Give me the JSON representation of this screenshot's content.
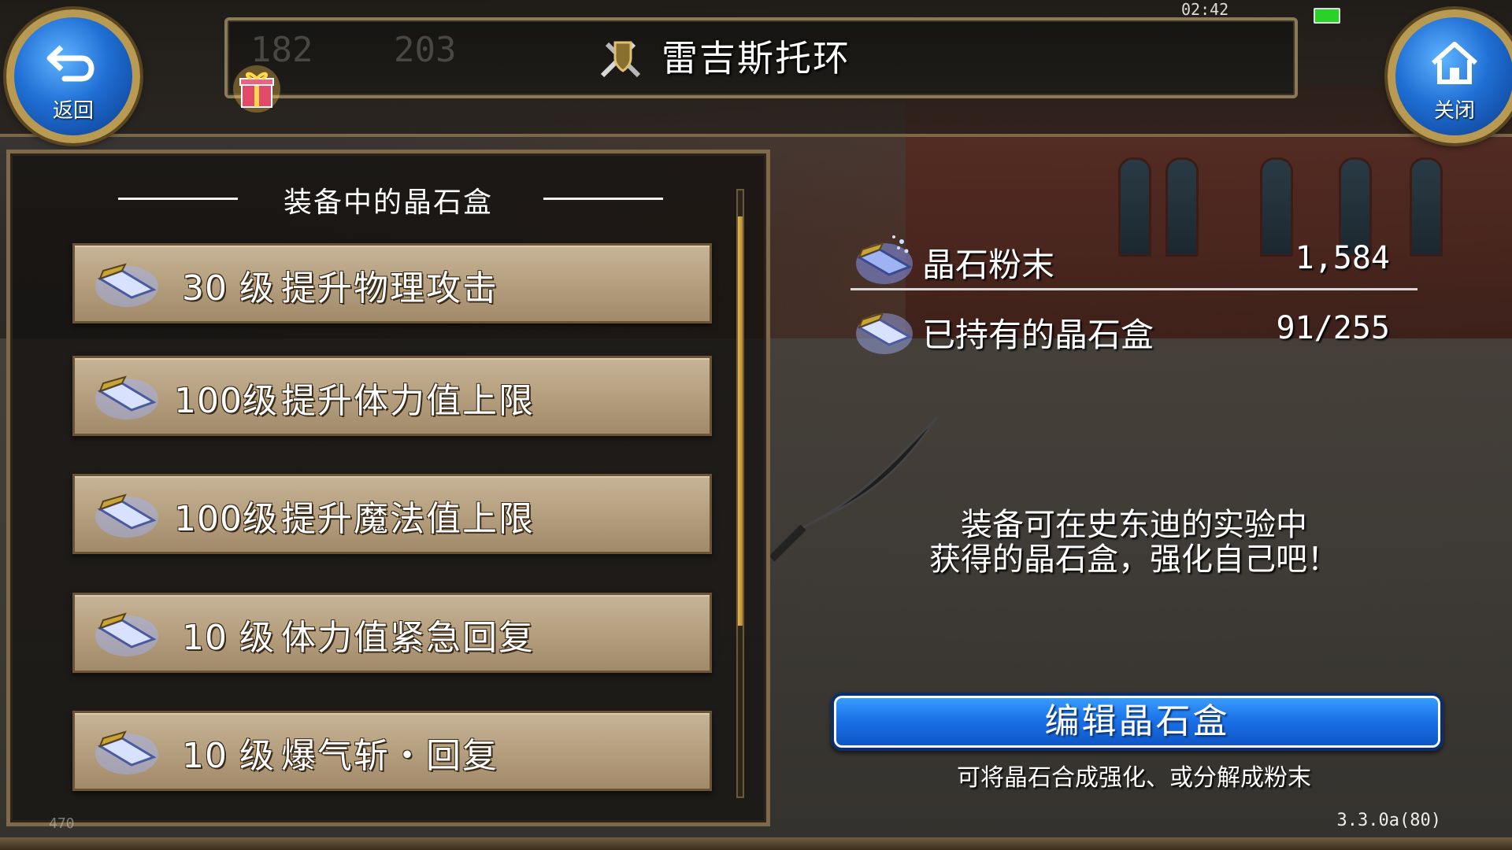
{
  "header": {
    "title": "雷吉斯托环",
    "title_icon": "crossed-swords-shield-icon",
    "faded_left": "182",
    "faded_right": "203",
    "status_time": "02:42",
    "back_button": {
      "label": "返回",
      "icon": "back-arrow-icon"
    },
    "close_button": {
      "label": "关闭",
      "icon": "home-icon"
    },
    "gift_icon": "gift-icon"
  },
  "left_panel": {
    "heading": "装备中的晶石盒",
    "items": [
      {
        "level": "30 级",
        "name": "提升物理攻击",
        "icon": "crystal-box-icon"
      },
      {
        "level": "100级",
        "name": "提升体力值上限",
        "icon": "crystal-box-icon"
      },
      {
        "level": "100级",
        "name": "提升魔法值上限",
        "icon": "crystal-box-icon"
      },
      {
        "level": "10 级",
        "name": "体力值紧急回复",
        "icon": "crystal-box-icon"
      },
      {
        "level": "10 级",
        "name": "爆气斩・回复",
        "icon": "crystal-box-icon"
      }
    ],
    "footer_partial": "470"
  },
  "stats": {
    "powder": {
      "label": "晶石粉末",
      "value": "1,584",
      "icon": "crystal-powder-icon"
    },
    "owned": {
      "label": "已持有的晶石盒",
      "value": "91/255",
      "icon": "crystal-box-icon"
    }
  },
  "description": {
    "line1": "装备可在史东迪的实验中",
    "line2": "获得的晶石盒，强化自己吧！"
  },
  "edit_button": {
    "label": "编辑晶石盒"
  },
  "edit_hint": "可将晶石合成强化、或分解成粉末",
  "version": "3.3.0a(80)",
  "colors": {
    "accent_blue": "#1a6fe6",
    "item_bg": "#b39d7c",
    "frame_gold": "#8a7a58"
  }
}
